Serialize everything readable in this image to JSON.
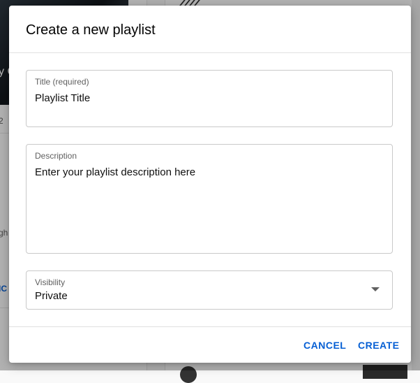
{
  "background": {
    "thumbnail_text": "y C",
    "fragments": [
      "2",
      "gh",
      "IC"
    ]
  },
  "dialog": {
    "title": "Create a new playlist",
    "fields": {
      "title": {
        "label": "Title (required)",
        "value": "Playlist Title"
      },
      "description": {
        "label": "Description",
        "value": "Enter your playlist description here"
      },
      "visibility": {
        "label": "Visibility",
        "value": "Private",
        "icon": "dropdown-arrow-icon"
      }
    },
    "buttons": {
      "cancel": "CANCEL",
      "create": "CREATE"
    }
  },
  "colors": {
    "accent": "#065fd4",
    "text": "#030303",
    "label": "#606060",
    "border": "#c9c9c9"
  }
}
